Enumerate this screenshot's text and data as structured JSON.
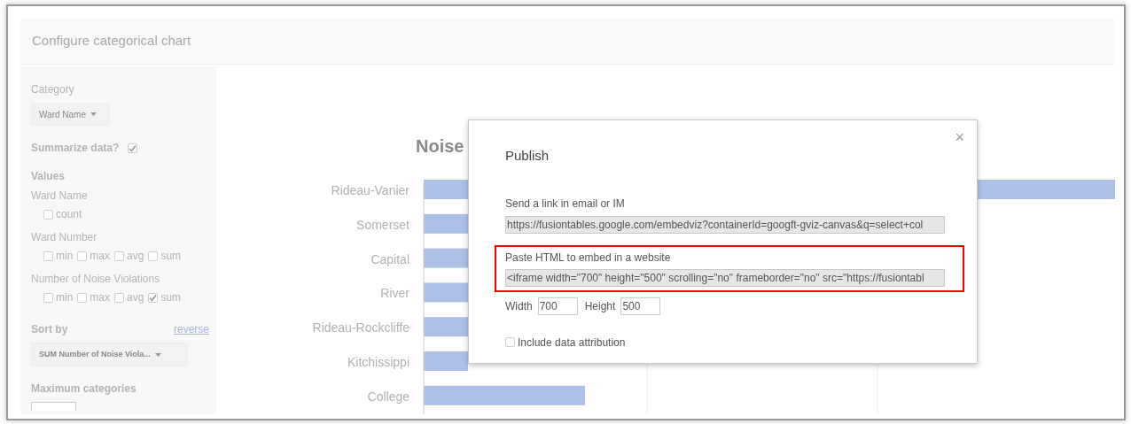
{
  "header": {
    "title": "Configure categorical chart"
  },
  "sidebar": {
    "category_label": "Category",
    "category_dropdown": "Ward Name",
    "summarize": {
      "label": "Summarize data?",
      "checked": true
    },
    "values_label": "Values",
    "value_groups": [
      {
        "name": "Ward Name",
        "options": [
          {
            "label": "count",
            "checked": false
          }
        ]
      },
      {
        "name": "Ward Number",
        "options": [
          {
            "label": "min",
            "checked": false
          },
          {
            "label": "max",
            "checked": false
          },
          {
            "label": "avg",
            "checked": false
          },
          {
            "label": "sum",
            "checked": false
          }
        ]
      },
      {
        "name": "Number of Noise Violations",
        "options": [
          {
            "label": "min",
            "checked": false
          },
          {
            "label": "max",
            "checked": false
          },
          {
            "label": "avg",
            "checked": false
          },
          {
            "label": "sum",
            "checked": true
          }
        ]
      }
    ],
    "sort_label": "Sort by",
    "reverse_link": "reverse",
    "sort_dropdown": "SUM Number of Noise Viola...",
    "max_categories_label": "Maximum categories"
  },
  "chart": {
    "title": "Noise",
    "categories": [
      "Rideau-Vanier",
      "Somerset",
      "Capital",
      "River",
      "Rideau-Rockcliffe",
      "Kitchissippi",
      "College"
    ]
  },
  "dialog": {
    "title": "Publish",
    "close": "×",
    "link_label": "Send a link in email or IM",
    "link_value": "https://fusiontables.google.com/embedviz?containerId=googft-gviz-canvas&q=select+col",
    "embed_label": "Paste HTML to embed in a website",
    "embed_value": "<iframe width=\"700\" height=\"500\" scrolling=\"no\" frameborder=\"no\" src=\"https://fusiontabl",
    "width_label": "Width",
    "width_value": "700",
    "height_label": "Height",
    "height_value": "500",
    "attribution": {
      "label": "Include data attribution",
      "checked": false
    }
  }
}
